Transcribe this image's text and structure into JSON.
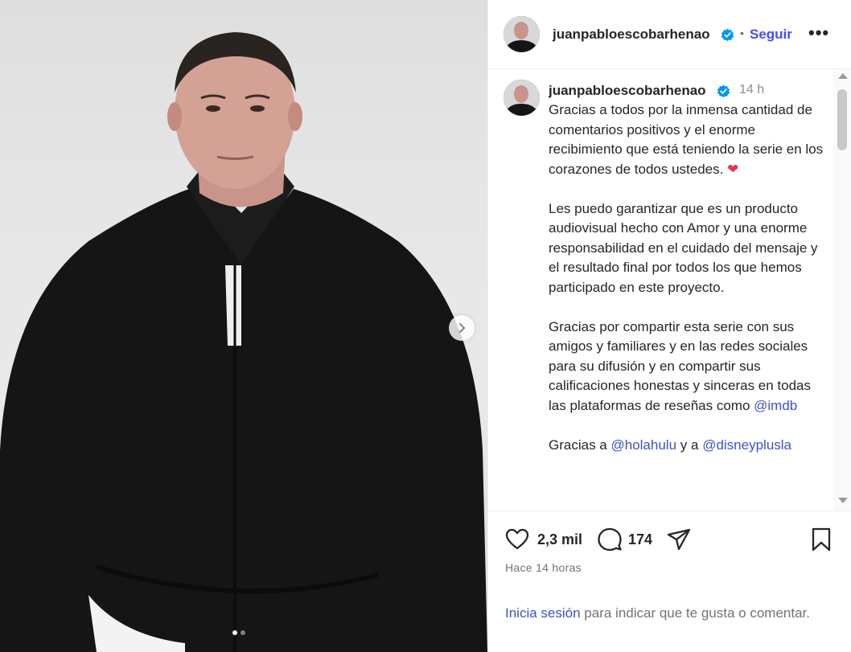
{
  "post": {
    "media": {
      "image_description_icon": "portrait-photo",
      "next_icon": "chevron-right-icon",
      "carousel_count": 2,
      "carousel_active_index": 0
    },
    "header": {
      "username": "juanpabloescobarhenao",
      "separator": "•",
      "follow_label": "Seguir",
      "more_label": "•••"
    },
    "caption": {
      "username": "juanpabloescobarhenao",
      "time": "14 h",
      "paragraph1": "Gracias a todos por la inmensa cantidad de comentarios positivos y el enorme recibimiento que está teniendo la serie en los corazones de todos ustedes.",
      "heart_emoji": "❤",
      "paragraph2": "Les puedo garantizar que es un producto audiovisual hecho con Amor y una enorme responsabilidad en el cuidado del mensaje y el resultado final por todos los que hemos participado en este proyecto.",
      "paragraph3": "Gracias por compartir esta serie con sus amigos y familiares y en las redes sociales para su difusión y en compartir sus calificaciones honestas y sinceras en todas las plataformas de reseñas como",
      "mention_imdb": "@imdb",
      "paragraph4_prefix": "Gracias a",
      "mention_hulu": "@holahulu",
      "paragraph4_mid": "y a",
      "mention_disney": "@disneyplusla"
    },
    "actions": {
      "likes_count": "2,3 mil",
      "comments_count": "174"
    },
    "timestamp": "Hace 14 horas",
    "login_prompt": {
      "link": "Inicia sesión",
      "text": "para indicar que te gusta o comentar."
    }
  },
  "colors": {
    "link": "#3d53c8",
    "follow": "#4150f7",
    "heart": "#e8325a",
    "verified": "#0095f6"
  }
}
